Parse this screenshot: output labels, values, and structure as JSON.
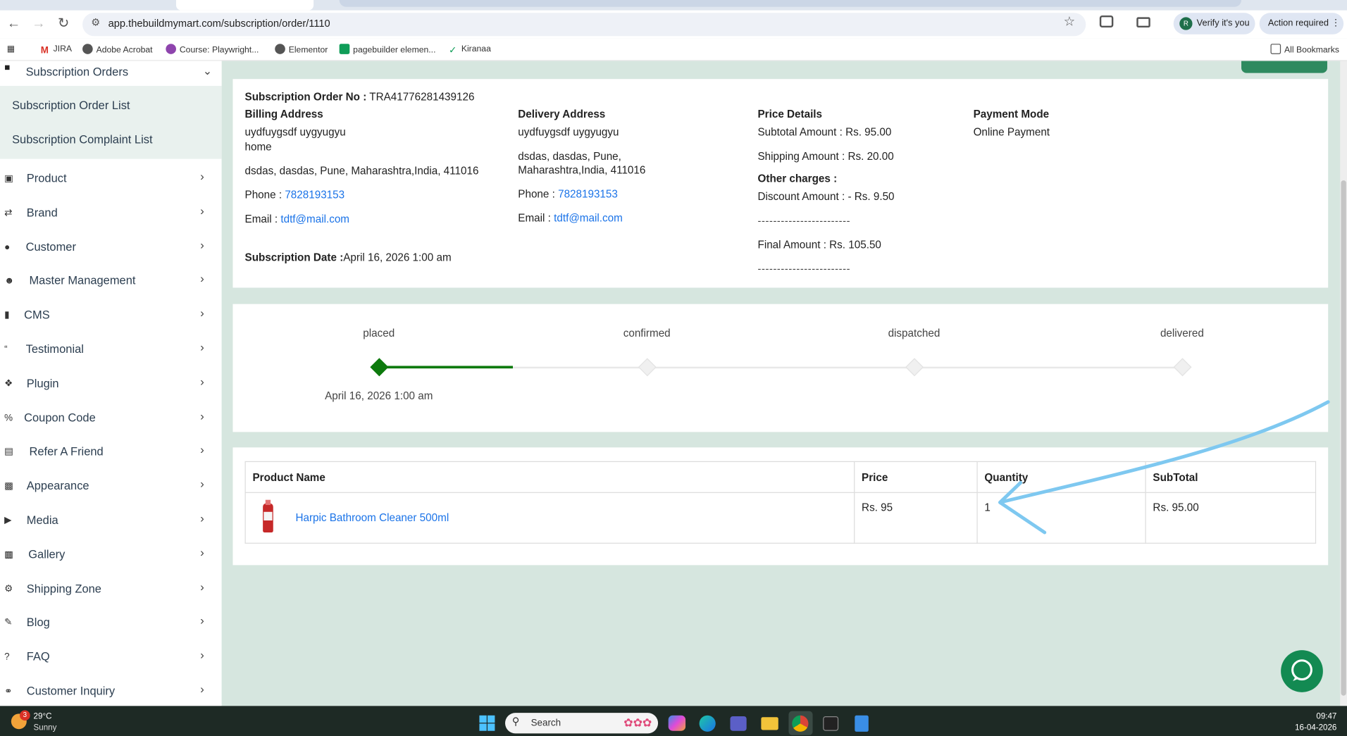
{
  "browser": {
    "url": "app.thebuildmymart.com/subscription/order/1110",
    "verify_label": "Verify it's you",
    "verify_avatar": "R",
    "action_label": "Action required"
  },
  "bookmarks": {
    "items": [
      "JIRA",
      "Adobe Acrobat",
      "Course: Playwright...",
      "Elementor",
      "pagebuilder elemen...",
      "Kiranaa"
    ],
    "all_bookmarks": "All Bookmarks"
  },
  "sidebar": {
    "section_title": "Subscription Orders",
    "sub_items": [
      "Subscription Order List",
      "Subscription Complaint List"
    ],
    "items": [
      {
        "label": "Product",
        "icon": "box-icon"
      },
      {
        "label": "Brand",
        "icon": "shuffle-icon"
      },
      {
        "label": "Customer",
        "icon": "user-icon"
      },
      {
        "label": "Master Management",
        "icon": "user-gear-icon"
      },
      {
        "label": "CMS",
        "icon": "document-icon"
      },
      {
        "label": "Testimonial",
        "icon": "quote-icon"
      },
      {
        "label": "Plugin",
        "icon": "puzzle-icon"
      },
      {
        "label": "Coupon Code",
        "icon": "percent-icon"
      },
      {
        "label": "Refer A Friend",
        "icon": "keyboard-icon"
      },
      {
        "label": "Appearance",
        "icon": "image-icon"
      },
      {
        "label": "Media",
        "icon": "play-circle-icon"
      },
      {
        "label": "Gallery",
        "icon": "images-icon"
      },
      {
        "label": "Shipping Zone",
        "icon": "gear-icon"
      },
      {
        "label": "Blog",
        "icon": "pencil-icon"
      },
      {
        "label": "FAQ",
        "icon": "question-circle-icon"
      },
      {
        "label": "Customer Inquiry",
        "icon": "headset-icon"
      }
    ]
  },
  "order": {
    "order_no_label": "Subscription Order No :",
    "order_no": "TRA41776281439126",
    "billing": {
      "title": "Billing Address",
      "name": "uydfuygsdf uygyugyu",
      "type": "home",
      "address": "dsdas, dasdas, Pune, Maharashtra,India, 411016",
      "phone_label": "Phone :",
      "phone": "7828193153",
      "email_label": "Email :",
      "email": "tdtf@mail.com"
    },
    "delivery": {
      "title": "Delivery Address",
      "name": "uydfuygsdf uygyugyu",
      "address_line1": "dsdas, dasdas, Pune,",
      "address_line2": "Maharashtra,India, 411016",
      "phone_label": "Phone :",
      "phone": "7828193153",
      "email_label": "Email :",
      "email": "tdtf@mail.com"
    },
    "subscription_date_label": "Subscription Date :",
    "subscription_date": "April 16, 2026 1:00 am",
    "price": {
      "title": "Price Details",
      "subtotal": "Subtotal Amount : Rs. 95.00",
      "shipping": "Shipping Amount : Rs. 20.00",
      "other_charges": "Other charges :",
      "discount": "Discount Amount : - Rs. 9.50",
      "separator": "------------------------",
      "final": "Final Amount : Rs.  105.50"
    },
    "payment": {
      "title": "Payment Mode",
      "mode": "Online Payment"
    }
  },
  "tracker": {
    "stages": [
      "placed",
      "confirmed",
      "dispatched",
      "delivered"
    ],
    "completed_stages": 1,
    "placed_date": "April 16, 2026 1:00 am",
    "active_color": "#0d7a0d"
  },
  "table": {
    "headers": [
      "Product Name",
      "Price",
      "Quantity",
      "SubTotal"
    ],
    "rows": [
      {
        "product": "Harpic Bathroom Cleaner 500ml",
        "price": "Rs. 95",
        "quantity": "1",
        "subtotal": "Rs. 95.00"
      }
    ]
  },
  "taskbar": {
    "weather_temp": "29°C",
    "weather_desc": "Sunny",
    "weather_badge": "3",
    "search_placeholder": "Search",
    "time": "09:47",
    "date": "16-04-2026"
  }
}
